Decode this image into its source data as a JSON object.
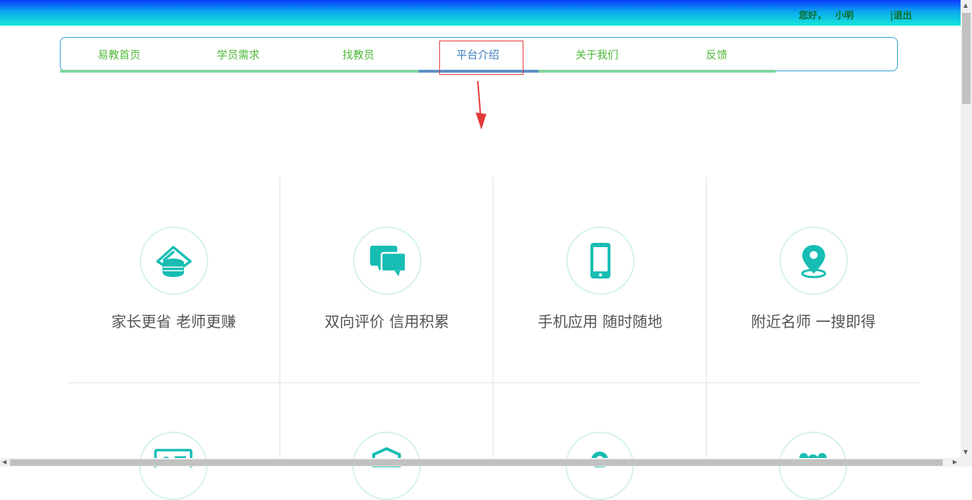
{
  "header": {
    "greeting": "您好，",
    "username": "小明",
    "logout": "|退出"
  },
  "nav": {
    "items": [
      {
        "label": "易教首页"
      },
      {
        "label": "学员需求"
      },
      {
        "label": "找教员"
      },
      {
        "label": "平台介绍",
        "active": true
      },
      {
        "label": "关于我们"
      },
      {
        "label": "反馈"
      }
    ]
  },
  "features": [
    {
      "title": "家长更省 老师更赚",
      "icon": "coins-card-icon"
    },
    {
      "title": "双向评价 信用积累",
      "icon": "chat-bubbles-icon"
    },
    {
      "title": "手机应用 随时随地",
      "icon": "smartphone-icon"
    },
    {
      "title": "附近名师 一搜即得",
      "icon": "location-pin-icon"
    }
  ],
  "colors": {
    "accent": "#17bdb3",
    "nav_text": "#4fb83a",
    "nav_active": "#3d7fc0",
    "annotation_red": "#e23a3a"
  }
}
